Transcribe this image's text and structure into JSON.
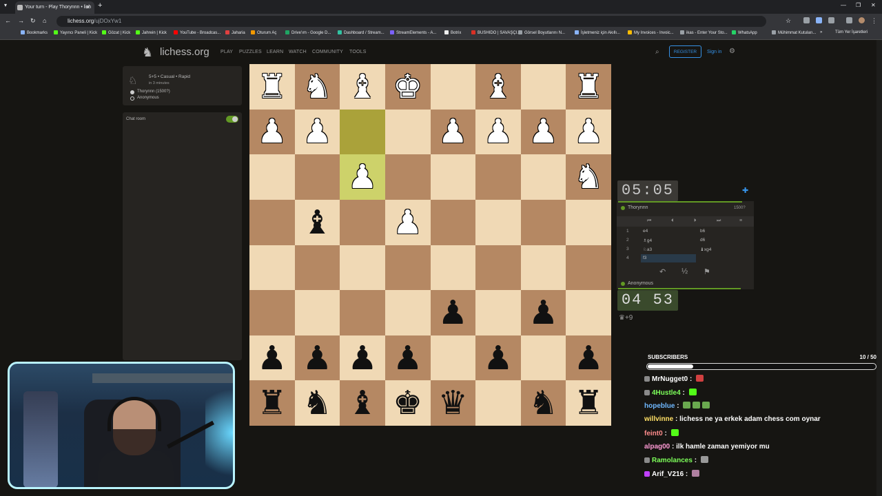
{
  "browser": {
    "tab_title": "Your turn - Play Thorynnn • lich",
    "url_host": "lichess.org",
    "url_path": "/ujDOxYw1",
    "bookmarks": [
      {
        "label": "Bookmarks",
        "color": "#8ab4f8"
      },
      {
        "label": "Yayıncı Paneli | Kick",
        "color": "#53fc18"
      },
      {
        "label": "Gözat | Kick",
        "color": "#53fc18"
      },
      {
        "label": "Jahrein | Kick",
        "color": "#53fc18"
      },
      {
        "label": "YouTube - Broadcas...",
        "color": "#ff0000"
      },
      {
        "label": "Jaharia",
        "color": "#e04040"
      },
      {
        "label": "Oturum Aç",
        "color": "#f29900"
      },
      {
        "label": "Drive'ım - Google D...",
        "color": "#1fa463"
      },
      {
        "label": "Dashboard / Stream...",
        "color": "#31c3a2"
      },
      {
        "label": "StreamElements - A...",
        "color": "#7b61ff"
      },
      {
        "label": "Botrix",
        "color": "#eeeeee"
      },
      {
        "label": "BUSHIDO | SAVAŞÇI...",
        "color": "#d93025"
      },
      {
        "label": "Görsel Boyutlarını N...",
        "color": "#9aa0a6"
      },
      {
        "label": "İşletmeniz için Akıllı...",
        "color": "#8ab4f8"
      },
      {
        "label": "My Invoices - Invoic...",
        "color": "#fbbc04"
      },
      {
        "label": "ikas - Enter Your Sto...",
        "color": "#9aa0a6"
      },
      {
        "label": "WhatsApp",
        "color": "#25d366"
      },
      {
        "label": "Mühimmat Kutuları...",
        "color": "#9aa0a6"
      }
    ],
    "all_bookmarks": "Tüm Yer İşaretleri"
  },
  "header": {
    "logo": "lichess.org",
    "nav": [
      "PLAY",
      "PUZZLES",
      "LEARN",
      "WATCH",
      "COMMUNITY",
      "TOOLS"
    ],
    "register": "REGISTER",
    "signin": "Sign in"
  },
  "game_info": {
    "mode": "5+5 • Casual • Rapid",
    "when": "in 3 minutes",
    "white_player": "Thorynnn (1500?)",
    "black_player": "Anonymous"
  },
  "chat": {
    "label": "Chat room"
  },
  "board": {
    "rows": [
      [
        "wR",
        "wN",
        "wB",
        "wK",
        "",
        "wB",
        "",
        "wR"
      ],
      [
        "wP",
        "wP",
        "",
        "",
        "wP",
        "wP",
        "wP",
        "wP"
      ],
      [
        "",
        "",
        "wP",
        "",
        "",
        "",
        "",
        "wN"
      ],
      [
        "",
        "bB",
        "",
        "wP",
        "",
        "",
        "",
        ""
      ],
      [
        "",
        "",
        "",
        "",
        "",
        "",
        "",
        ""
      ],
      [
        "",
        "",
        "",
        "",
        "bP",
        "",
        "bP",
        ""
      ],
      [
        "bP",
        "bP",
        "bP",
        "bP",
        "",
        "bP",
        "",
        "bP"
      ],
      [
        "bR",
        "bN",
        "bB",
        "bK",
        "bQ",
        "",
        "bN",
        "bR"
      ]
    ],
    "highlight": [
      [
        1,
        2
      ],
      [
        2,
        2
      ]
    ],
    "glyphs": {
      "K": "♚",
      "Q": "♛",
      "R": "♜",
      "B": "♝",
      "N": "♞",
      "P": "♟"
    }
  },
  "clocks": {
    "top": "05:05",
    "bottom": "04 53"
  },
  "players": {
    "top": {
      "name": "Thorynnn",
      "rating": "1500?"
    },
    "bottom": {
      "name": "Anonymous"
    }
  },
  "moves": [
    {
      "num": "1",
      "white": "e4",
      "black": "b6"
    },
    {
      "num": "2",
      "white": "♗g4",
      "black": "d6"
    },
    {
      "num": "3",
      "white": "♘a3",
      "black": "♝xg4"
    },
    {
      "num": "4",
      "white": "f3",
      "black": ""
    }
  ],
  "actions": {
    "takeback": "↶",
    "draw": "½",
    "resign": "⚑"
  },
  "pocket": "♛+9",
  "stream": {
    "subs_title": "SUBSCRIBERS",
    "subs_count": "10 / 50",
    "subs_progress": 0.2,
    "chat": [
      {
        "user": "MrNugget0",
        "color": "#ffffff",
        "badge": "#8a8a8a",
        "text": "",
        "emotes": [
          "#d04040"
        ]
      },
      {
        "user": "4Hustle4",
        "color": "#7dff5a",
        "badge": "#8a8a8a",
        "text": "",
        "emotes": [
          "#53fc18"
        ]
      },
      {
        "user": "hopeblue",
        "color": "#6fb8ff",
        "badge": "",
        "text": "",
        "emotes": [
          "#6aa84f",
          "#6aa84f",
          "#6aa84f"
        ]
      },
      {
        "user": "willvinne",
        "color": "#ffe066",
        "badge": "",
        "text": "lichess ne ya erkek adam chess com oynar",
        "emotes": []
      },
      {
        "user": "feint0",
        "color": "#ff8c8c",
        "badge": "",
        "text": "",
        "emotes": [
          "#53fc18"
        ]
      },
      {
        "user": "alpag00",
        "color": "#ff9ad5",
        "badge": "",
        "text": "ilk hamle zaman yemiyor mu",
        "emotes": []
      },
      {
        "user": "Ramolances",
        "color": "#7dff5a",
        "badge": "#8a8a8a",
        "text": "",
        "emotes": [
          "#999999"
        ]
      },
      {
        "user": "Arif_V216",
        "color": "#ffffff",
        "badge": "#c040ff",
        "text": "",
        "emotes": [
          "#b080a0"
        ]
      }
    ]
  }
}
